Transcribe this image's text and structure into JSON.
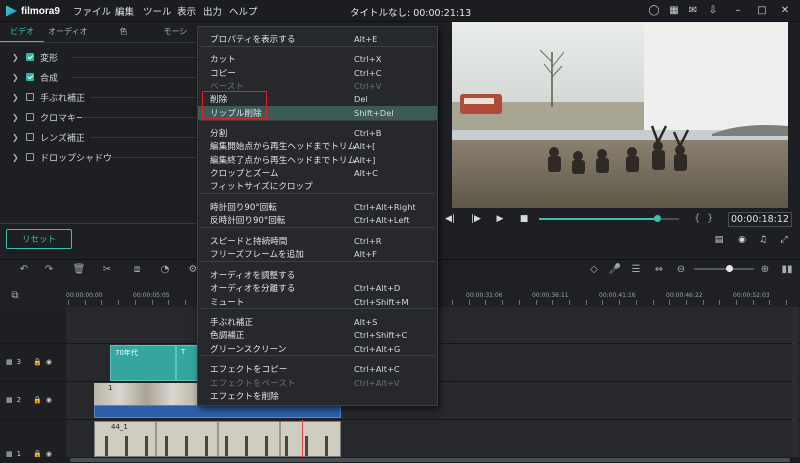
{
  "app": {
    "logo_text": "filmora9",
    "title": "タイトルなし: 00:00:21:13"
  },
  "menubar": [
    "ファイル",
    "編集",
    "ツール",
    "表示",
    "出力",
    "ヘルプ"
  ],
  "window_icons": [
    "profile-icon",
    "cart-icon",
    "mail-icon",
    "download-icon",
    "minimize-icon",
    "maximize-icon",
    "close-icon"
  ],
  "left_panel": {
    "tabs": [
      "ビデオ",
      "オーディオ",
      "色",
      "モーシ"
    ],
    "active_tab": "ビデオ",
    "properties": [
      {
        "label": "変形",
        "expandable": true,
        "checked": true
      },
      {
        "label": "合成",
        "expandable": true,
        "checked": true
      },
      {
        "label": "手ぶれ補正",
        "expandable": true,
        "checked": false
      },
      {
        "label": "クロマキー",
        "expandable": true,
        "checked": false
      },
      {
        "label": "レンズ補正",
        "expandable": true,
        "checked": false
      },
      {
        "label": "ドロップシャドウ",
        "expandable": true,
        "checked": false
      }
    ],
    "reset_label": "リセット"
  },
  "context_menu": {
    "items": [
      {
        "label": "プロパティを表示する",
        "shortcut": "Alt+E",
        "enabled": true
      },
      {
        "separator": true
      },
      {
        "label": "カット",
        "shortcut": "Ctrl+X",
        "enabled": true
      },
      {
        "label": "コピー",
        "shortcut": "Ctrl+C",
        "enabled": true
      },
      {
        "label": "ペースト",
        "shortcut": "Ctrl+V",
        "enabled": false
      },
      {
        "label": "削除",
        "shortcut": "Del",
        "enabled": true
      },
      {
        "label": "リップル削除",
        "shortcut": "Shift+Del",
        "enabled": true,
        "highlighted": true
      },
      {
        "separator": true
      },
      {
        "label": "分割",
        "shortcut": "Ctrl+B",
        "enabled": true
      },
      {
        "label": "編集開始点から再生ヘッドまでトリム",
        "shortcut": "Alt+[",
        "enabled": true
      },
      {
        "label": "編集終了点から再生ヘッドまでトリム",
        "shortcut": "Alt+]",
        "enabled": true
      },
      {
        "label": "クロップとズーム",
        "shortcut": "Alt+C",
        "enabled": true
      },
      {
        "label": "フィットサイズにクロップ",
        "shortcut": "",
        "enabled": true
      },
      {
        "separator": true
      },
      {
        "label": "時計回り90°回転",
        "shortcut": "Ctrl+Alt+Right",
        "enabled": true
      },
      {
        "label": "反時計回り90°回転",
        "shortcut": "Ctrl+Alt+Left",
        "enabled": true
      },
      {
        "separator": true
      },
      {
        "label": "スピードと持続時間",
        "shortcut": "Ctrl+R",
        "enabled": true
      },
      {
        "label": "フリーズフレームを追加",
        "shortcut": "Alt+F",
        "enabled": true
      },
      {
        "separator": true
      },
      {
        "label": "オーディオを調整する",
        "shortcut": "",
        "enabled": true
      },
      {
        "label": "オーディオを分離する",
        "shortcut": "Ctrl+Alt+D",
        "enabled": true
      },
      {
        "label": "ミュート",
        "shortcut": "Ctrl+Shift+M",
        "enabled": true
      },
      {
        "separator": true
      },
      {
        "label": "手ぶれ補正",
        "shortcut": "Alt+S",
        "enabled": true
      },
      {
        "label": "色調補正",
        "shortcut": "Ctrl+Shift+C",
        "enabled": true
      },
      {
        "label": "グリーンスクリーン",
        "shortcut": "Ctrl+Alt+G",
        "enabled": true
      },
      {
        "separator": true
      },
      {
        "label": "エフェクトをコピー",
        "shortcut": "Ctrl+Alt+C",
        "enabled": true
      },
      {
        "label": "エフェクトをペースト",
        "shortcut": "Ctrl+Alt+V",
        "enabled": false
      },
      {
        "label": "エフェクトを削除",
        "shortcut": "",
        "enabled": true
      }
    ]
  },
  "preview": {
    "timecode": "00:00:18:12",
    "progress": 0.84,
    "bracket_left": "{",
    "bracket_right": "}"
  },
  "ruler": {
    "labels": [
      "00:00:00:00",
      "00:00:05:05",
      "00:00:31:06",
      "00:00:36:11",
      "00:00:41:16",
      "00:00:46:22",
      "00:00:52:03"
    ]
  },
  "timeline": {
    "tracks": [
      {
        "number": "3",
        "clips": [
          {
            "label": "70年代"
          },
          {
            "label": "T"
          }
        ]
      },
      {
        "number": "2",
        "clips": [
          {
            "label": "1"
          }
        ]
      },
      {
        "number": "1",
        "clips": [
          {
            "label": "44_1"
          }
        ]
      }
    ]
  },
  "colors": {
    "accent": "#37c3b0",
    "highlight": "#3a5b58",
    "redbox": "#e0202a",
    "playhead": "#e04343"
  }
}
